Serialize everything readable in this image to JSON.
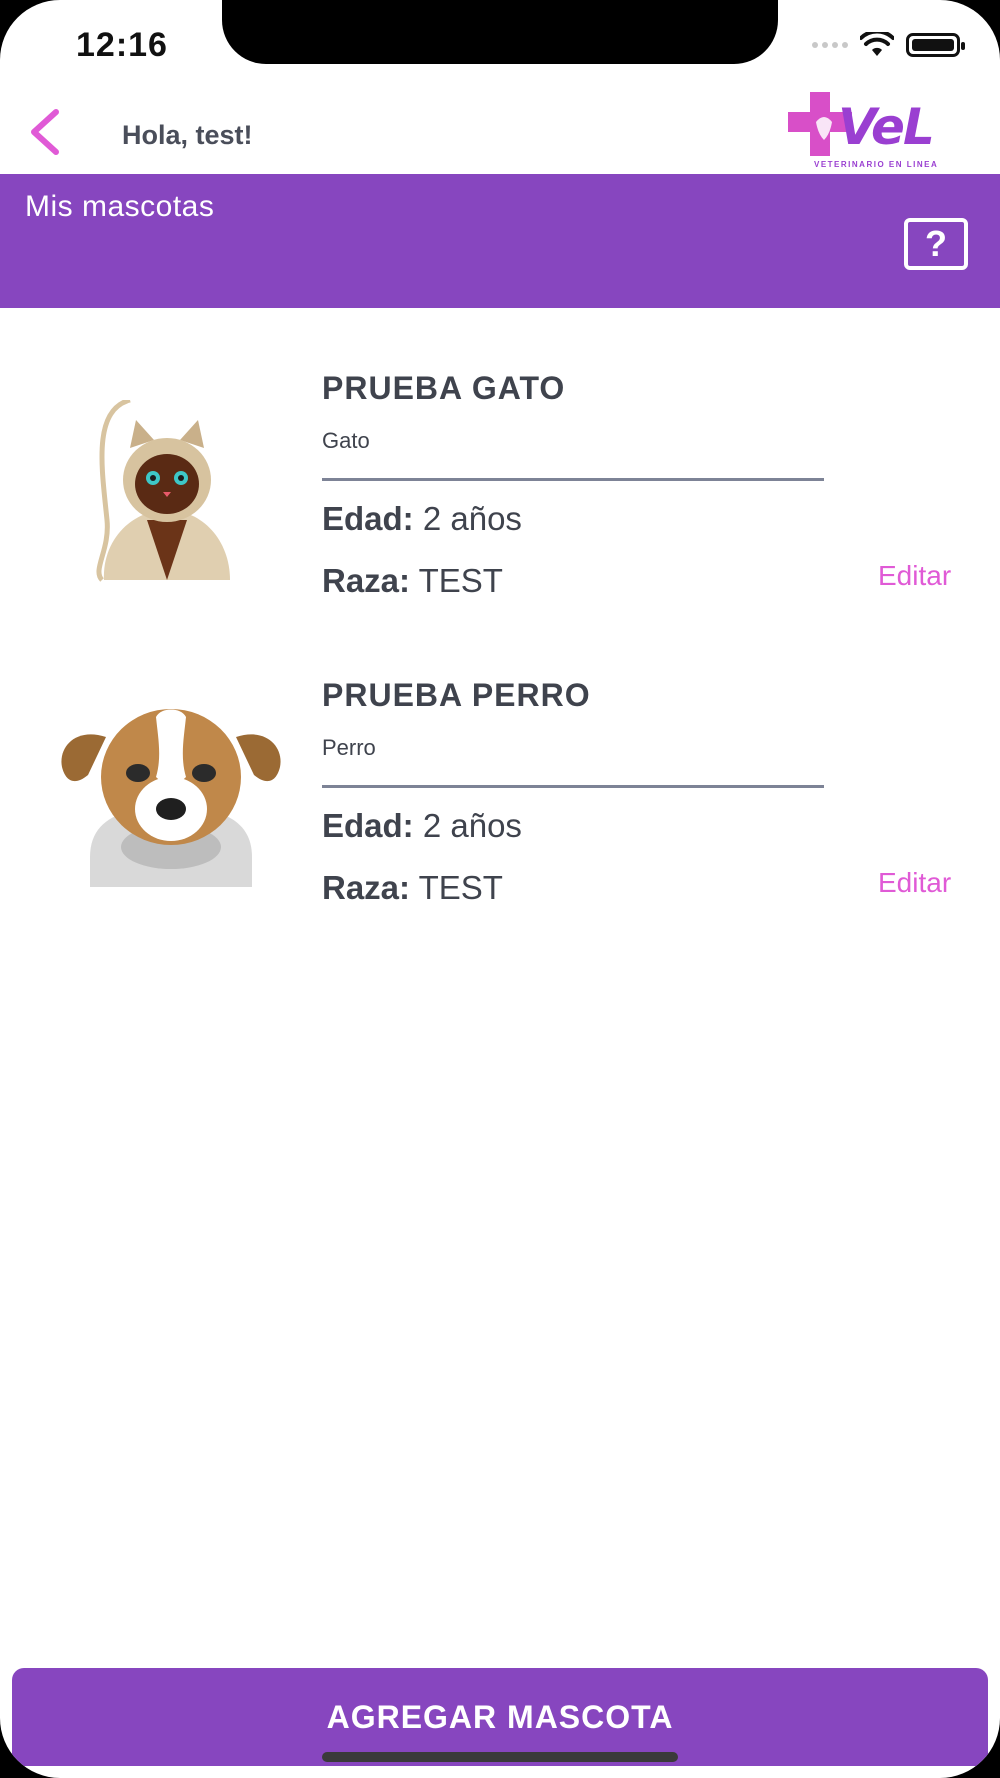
{
  "status_bar": {
    "time": "12:16"
  },
  "header": {
    "greeting": "Hola, test!",
    "logo_text": "VeL",
    "logo_subtitle": "VETERINARIO EN LINEA"
  },
  "title_bar": {
    "title": "Mis mascotas",
    "help_label": "?"
  },
  "pets": [
    {
      "name": "PRUEBA GATO",
      "species": "Gato",
      "age_label": "Edad:",
      "age_value": "2 años",
      "breed_label": "Raza:",
      "breed_value": "TEST",
      "edit_label": "Editar",
      "icon": "cat-icon"
    },
    {
      "name": "PRUEBA PERRO",
      "species": "Perro",
      "age_label": "Edad:",
      "age_value": "2 años",
      "breed_label": "Raza:",
      "breed_value": "TEST",
      "edit_label": "Editar",
      "icon": "dog-icon"
    }
  ],
  "footer": {
    "add_button": "AGREGAR MASCOTA"
  },
  "colors": {
    "primary": "#8746bf",
    "accent": "#e05ad6",
    "text": "#3f434d"
  }
}
